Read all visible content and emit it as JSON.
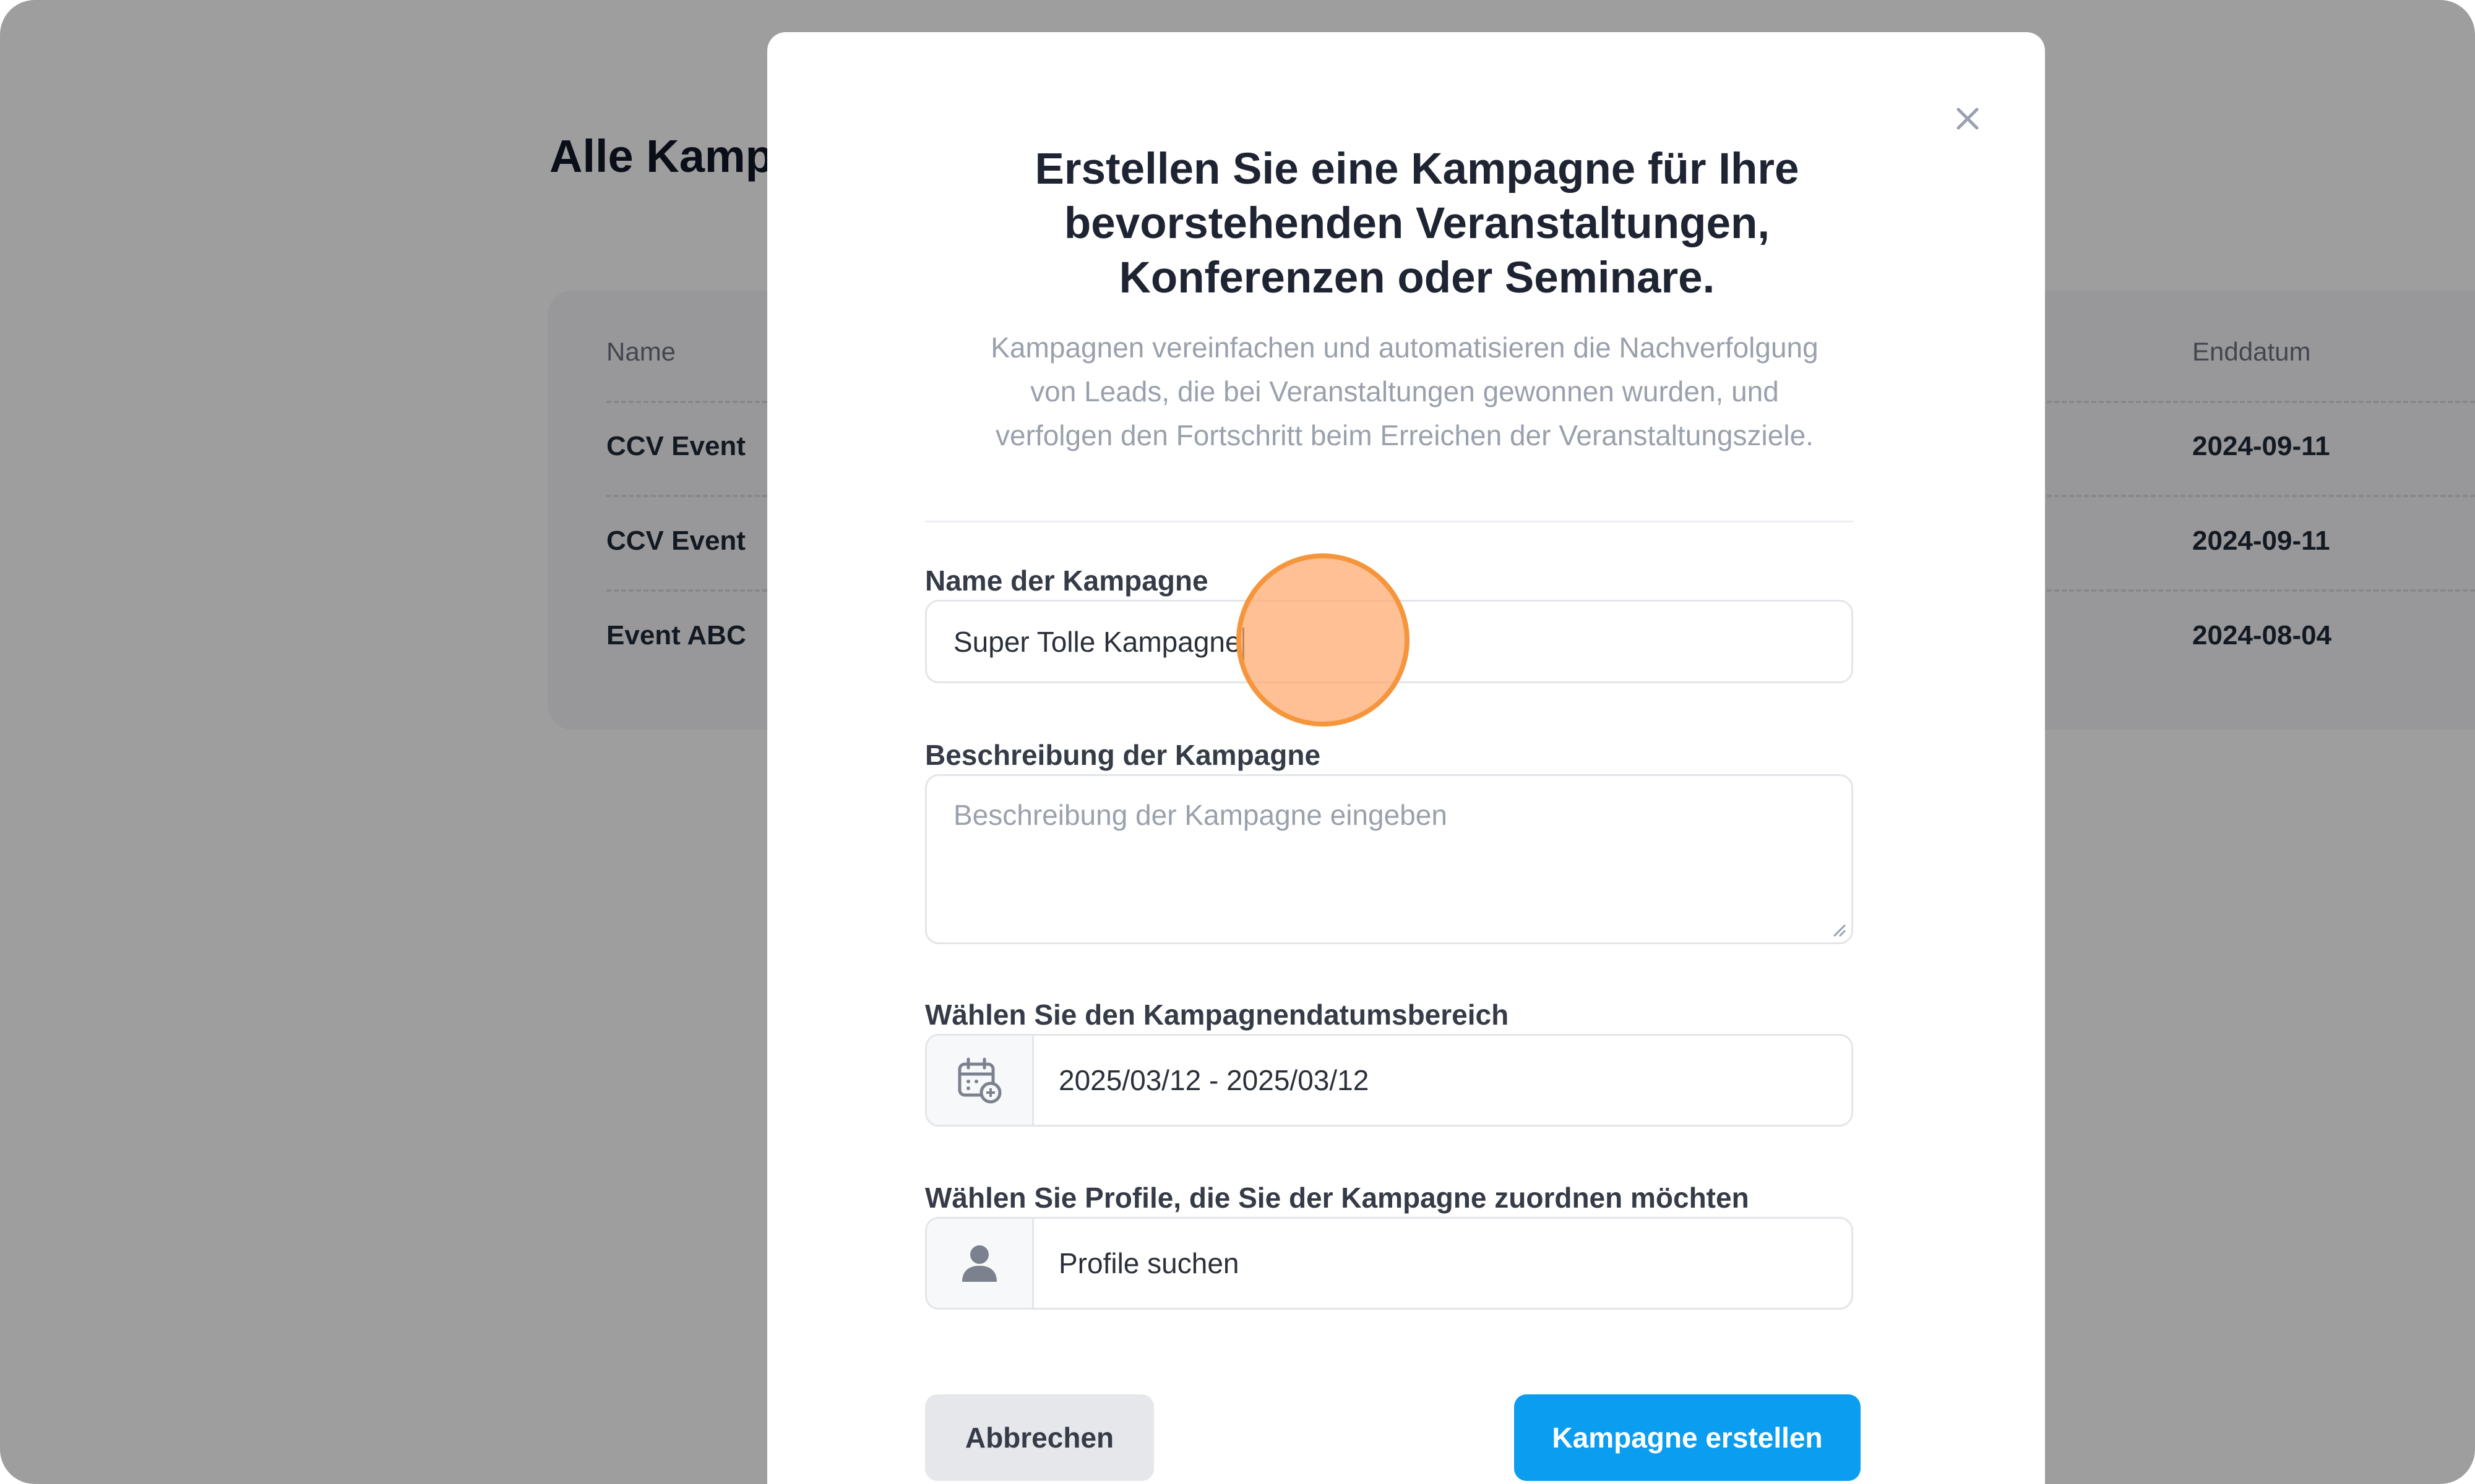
{
  "background_page": {
    "title": "Alle Kamp",
    "table": {
      "headers": {
        "name": "Name",
        "end_date": "Enddatum"
      },
      "rows": [
        {
          "name": "CCV Event",
          "end_date": "2024-09-11"
        },
        {
          "name": "CCV Event",
          "end_date": "2024-09-11"
        },
        {
          "name": "Event ABC",
          "end_date": "2024-08-04"
        }
      ]
    }
  },
  "modal": {
    "close_icon": "close-icon",
    "title_lines": [
      "Erstellen Sie eine Kampagne für Ihre",
      "bevorstehenden Veranstaltungen,",
      "Konferenzen oder Seminare."
    ],
    "subtitle_lines": [
      "Kampagnen vereinfachen und automatisieren die Nachverfolgung",
      "von Leads, die bei Veranstaltungen gewonnen wurden, und",
      "verfolgen den Fortschritt beim Erreichen der Veranstaltungsziele."
    ],
    "campaign_name": {
      "label": "Name der Kampagne",
      "value": "Super Tolle Kampagne"
    },
    "campaign_description": {
      "label": "Beschreibung der Kampagne",
      "placeholder": "Beschreibung der Kampagne eingeben"
    },
    "date_range": {
      "label": "Wählen Sie den Kampagnendatumsbereich",
      "icon": "calendar-icon",
      "value": "2025/03/12 - 2025/03/12"
    },
    "profiles": {
      "label": "Wählen Sie Profile, die Sie der Kampagne zuordnen möchten",
      "icon": "user-icon",
      "placeholder": "Profile suchen"
    },
    "buttons": {
      "cancel": "Abbrechen",
      "create": "Kampagne erstellen"
    }
  },
  "colors": {
    "primary": "#0b9df0",
    "click_indicator": "#f5963d"
  }
}
